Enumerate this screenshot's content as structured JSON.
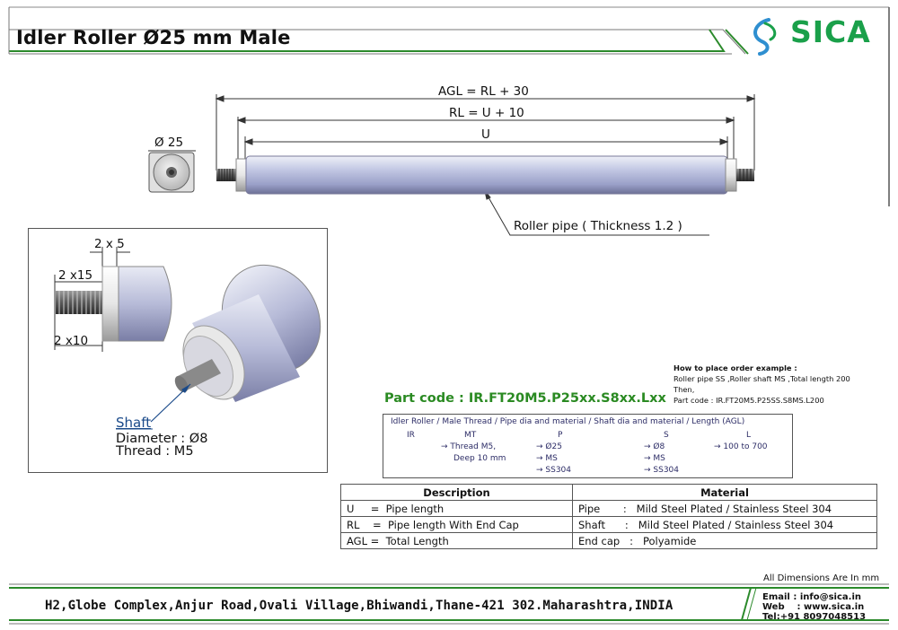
{
  "title": "Idler Roller Ø25 mm Male",
  "logo": {
    "name": "SICA",
    "color": "#1aa04a"
  },
  "dimensions": {
    "agl": "AGL = RL + 30",
    "rl": "RL = U + 10",
    "u": "U",
    "diameter": "Ø 25",
    "roller_pipe": "Roller pipe ( Thickness 1.2 )"
  },
  "detail": {
    "dim_2x5": "2 x 5",
    "dim_2x15": "2 x15",
    "dim_2x10": "2 x10",
    "shaft_label": "Shaft",
    "shaft_diameter": "Diameter : Ø8",
    "shaft_thread": "Thread : M5"
  },
  "order_info": {
    "heading": "How to place order example :",
    "line1": "Roller pipe SS ,Roller shaft MS ,Total length 200",
    "line2": "Then,",
    "line3": "Part code : IR.FT20M5.P25SS.S8MS.L200"
  },
  "part_code": "Part code : IR.FT20M5.P25xx.S8xx.Lxx",
  "code_table": {
    "header": "Idler Roller / Male Thread / Pipe dia and material / Shaft dia and material / Length (AGL)",
    "columns": [
      {
        "key": "IR",
        "lines": []
      },
      {
        "key": "MT",
        "lines": [
          "→ Thread M5,",
          "Deep 10 mm"
        ]
      },
      {
        "key": "P",
        "lines": [
          "→ Ø25",
          "→ MS",
          "→ SS304"
        ]
      },
      {
        "key": "S",
        "lines": [
          "→ Ø8",
          "→ MS",
          "→ SS304"
        ]
      },
      {
        "key": "L",
        "lines": [
          "→ 100 to 700"
        ]
      }
    ]
  },
  "desc_table": {
    "headers": [
      "Description",
      "Material"
    ],
    "rows": [
      [
        "U     =  Pipe length",
        "Pipe       :   Mild Steel Plated / Stainless Steel 304"
      ],
      [
        "RL    =  Pipe length With End Cap",
        "Shaft      :   Mild Steel Plated / Stainless Steel 304"
      ],
      [
        "AGL =  Total Length",
        "End cap   :   Polyamide"
      ]
    ]
  },
  "all_dims": "All Dimensions Are In mm",
  "footer": {
    "address": "H2,Globe Complex,Anjur Road,Ovali Village,Bhiwandi,Thane-421 302.Maharashtra,INDIA",
    "email": "Email : info@sica.in",
    "web": "Web    : www.sica.in",
    "tel": "Tel:+91 8097048513"
  }
}
